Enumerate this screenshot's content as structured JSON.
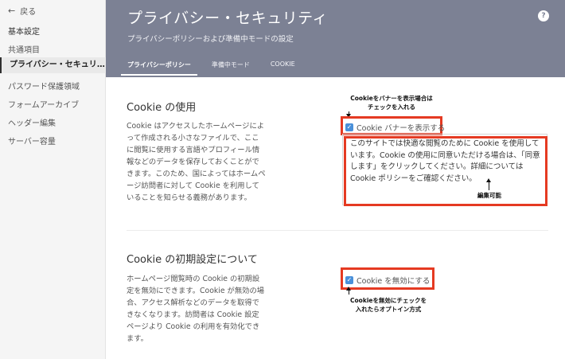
{
  "sidebar": {
    "back_label": "戻る",
    "section_label": "基本設定",
    "items": [
      {
        "label": "共通項目"
      },
      {
        "label": "プライバシー・セキュリティ..."
      },
      {
        "label": "パスワード保護領域"
      },
      {
        "label": "フォームアーカイブ"
      },
      {
        "label": "ヘッダー編集"
      },
      {
        "label": "サーバー容量"
      }
    ]
  },
  "header": {
    "title": "プライバシー・セキュリティ",
    "subtitle": "プライバシーポリシーおよび準備中モードの設定",
    "help_icon_label": "?",
    "tabs": [
      {
        "label": "プライバシーポリシー",
        "active": true
      },
      {
        "label": "準備中モード",
        "active": false
      },
      {
        "label": "COOKIE",
        "active": false
      }
    ]
  },
  "cookie_usage": {
    "title": "Cookie の使用",
    "description": "Cookie はアクセスしたホームページによって作成される小さなファイルで、ここに閲覧に使用する言語やプロフィール情報などのデータを保存しておくことができます。このため、国によってはホームページ訪問者に対して Cookie を利用していることを知らせる義務があります。",
    "checkbox_label": "Cookie バナーを表示する",
    "checkbox_checked": true,
    "banner_text": "このサイトでは快適な閲覧のために Cookie を使用しています。Cookie の使用に同意いただける場合は、「同意します」をクリックしてください。詳細については Cookie ポリシーをご確認ください。"
  },
  "cookie_default": {
    "title": "Cookie の初期設定について",
    "description": "ホームページ閲覧時の Cookie の初期設定を無効にできます。Cookie が無効の場合、アクセス解析などのデータを取得できなくなります。訪問者は Cookie 設定ページより Cookie の利用を有効化できます。",
    "checkbox_label": "Cookie を無効にする",
    "checkbox_checked": true
  },
  "annotations": {
    "banner_note_line1": "Cookieをバナーを表示場合は",
    "banner_note_line2": "チェックを入れる",
    "editable_note": "編集可能",
    "disable_note_line1": "Cookieを無効にチェックを",
    "disable_note_line2": "入れたらオプトイン方式"
  },
  "colors": {
    "header_bg": "#7c8194",
    "sidebar_bg": "#f5f5f5",
    "checkbox": "#4a90d9",
    "annotation_red": "#e53a22"
  }
}
